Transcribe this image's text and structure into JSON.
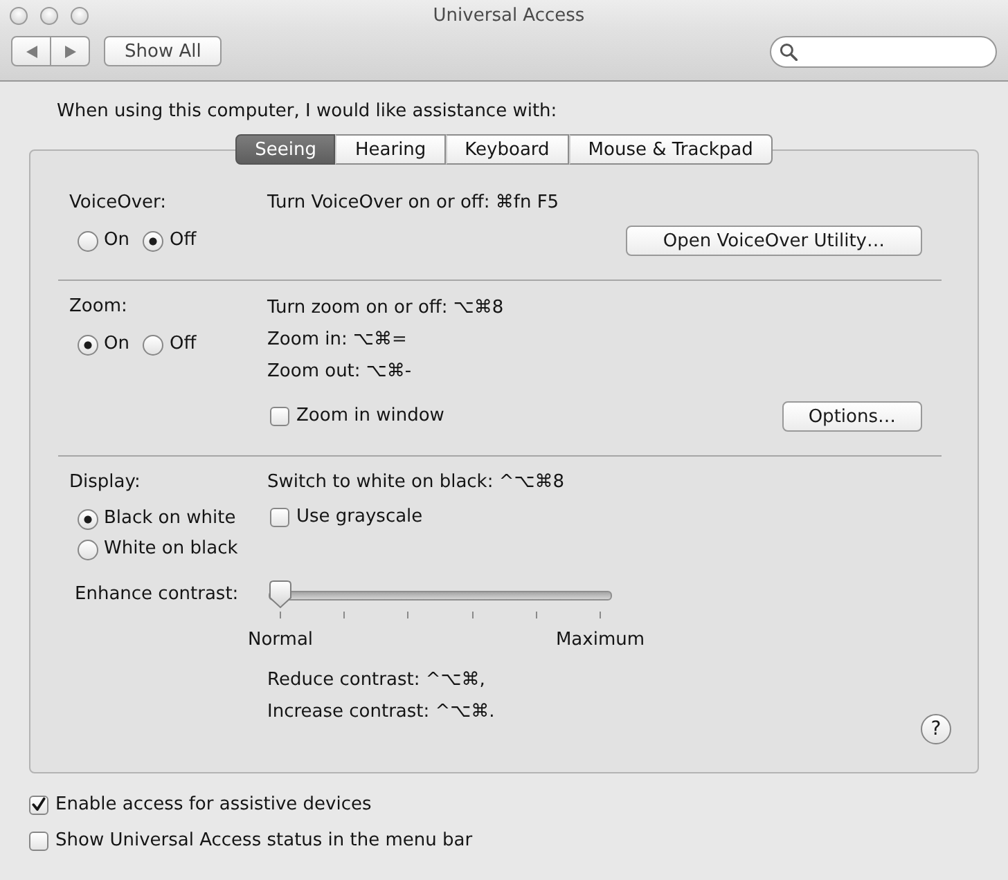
{
  "window": {
    "title": "Universal Access"
  },
  "toolbar": {
    "show_all": "Show All"
  },
  "intro": "When using this computer, I would like assistance with:",
  "tabs": [
    {
      "label": "Seeing",
      "selected": true
    },
    {
      "label": "Hearing",
      "selected": false
    },
    {
      "label": "Keyboard",
      "selected": false
    },
    {
      "label": "Mouse & Trackpad",
      "selected": false
    }
  ],
  "sections": [
    {
      "kind": "voiceover",
      "label": "VoiceOver:",
      "shortcuts": [
        "Turn VoiceOver on or off: ⌘fn F5"
      ],
      "radios": [
        {
          "label": "On",
          "selected": false
        },
        {
          "label": "Off",
          "selected": true
        }
      ],
      "button": "Open VoiceOver Utility…"
    },
    {
      "kind": "zoom",
      "label": "Zoom:",
      "shortcuts": [
        "Turn zoom on or off: ⌥⌘8",
        "Zoom in: ⌥⌘=",
        "Zoom out: ⌥⌘-"
      ],
      "radios": [
        {
          "label": "On",
          "selected": true
        },
        {
          "label": "Off",
          "selected": false
        }
      ],
      "checkbox": {
        "label": "Zoom in window",
        "checked": false
      },
      "button": "Options…"
    },
    {
      "kind": "display",
      "label": "Display:",
      "shortcuts": [
        "Switch to white on black: ^⌥⌘8"
      ],
      "radios": [
        {
          "label": "Black on white",
          "selected": true
        },
        {
          "label": "White on black",
          "selected": false
        }
      ],
      "checkbox": {
        "label": "Use grayscale",
        "checked": false
      },
      "slider": {
        "label": "Enhance contrast:",
        "level": 0,
        "min_label": "Normal",
        "max_label": "Maximum"
      },
      "notes": [
        "Reduce contrast: ^⌥⌘,",
        "Increase contrast: ^⌥⌘."
      ]
    }
  ],
  "help_button": "?",
  "options": [
    {
      "label": "Enable access for assistive devices",
      "checked": true
    },
    {
      "label": "Show Universal Access status in the menu bar",
      "checked": false
    }
  ]
}
